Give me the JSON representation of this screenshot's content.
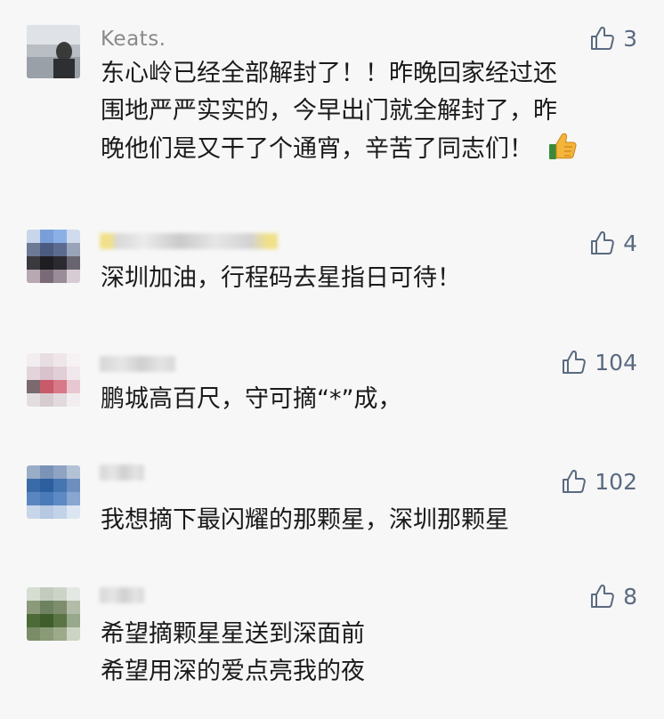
{
  "comments": [
    {
      "name": "Keats.",
      "likes": "3",
      "lines": [
        "东心岭已经全部解封了！！昨晚回家经过还",
        "围地严严实实的，今早出门就全解封了，昨",
        "晚他们是又干了个通宵，辛苦了同志们！"
      ],
      "emoji": "thumbs-up-emoji"
    },
    {
      "name": "",
      "likes": "4",
      "lines": [
        "深圳加油，行程码去星指日可待！"
      ]
    },
    {
      "name": "",
      "likes": "104",
      "lines": [
        "鹏城高百尺，守可摘“*”成，"
      ]
    },
    {
      "name": "",
      "likes": "102",
      "lines": [
        "我想摘下最闪耀的那颗星，深圳那颗星"
      ]
    },
    {
      "name": "",
      "likes": "8",
      "lines": [
        "希望摘颗星星送到深面前",
        "希望用深的爱点亮我的夜"
      ]
    }
  ],
  "colors": {
    "background": "#f7f7f7",
    "name": "#8a8a8a",
    "like": "#5a6a80",
    "text": "#1a1a1a"
  }
}
